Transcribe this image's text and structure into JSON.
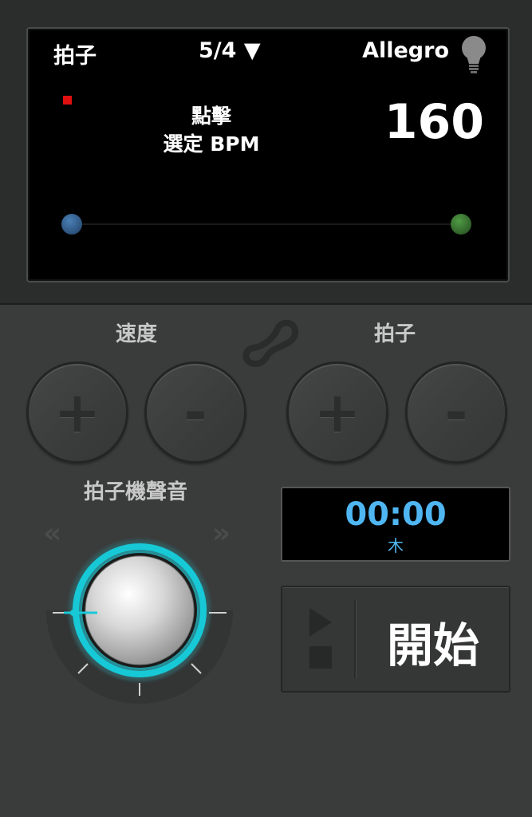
{
  "display": {
    "beat_label": "拍子",
    "time_signature": "5/4 ▼",
    "tempo_name": "Allegro",
    "tap_hint_line1": "點擊",
    "tap_hint_line2": "選定 BPM",
    "bpm": "160"
  },
  "controls": {
    "tempo_label": "速度",
    "beat_label": "拍子",
    "plus": "+",
    "minus": "-",
    "sound_label": "拍子機聲音"
  },
  "timer": {
    "value": "00:00",
    "sound_name": "木"
  },
  "start": {
    "label": "開始"
  },
  "knob": {
    "prev": "«",
    "next": "»"
  },
  "colors": {
    "accent_cyan": "#17c9d6",
    "timer_blue": "#4fb6f2",
    "beat_red": "#e01010"
  }
}
